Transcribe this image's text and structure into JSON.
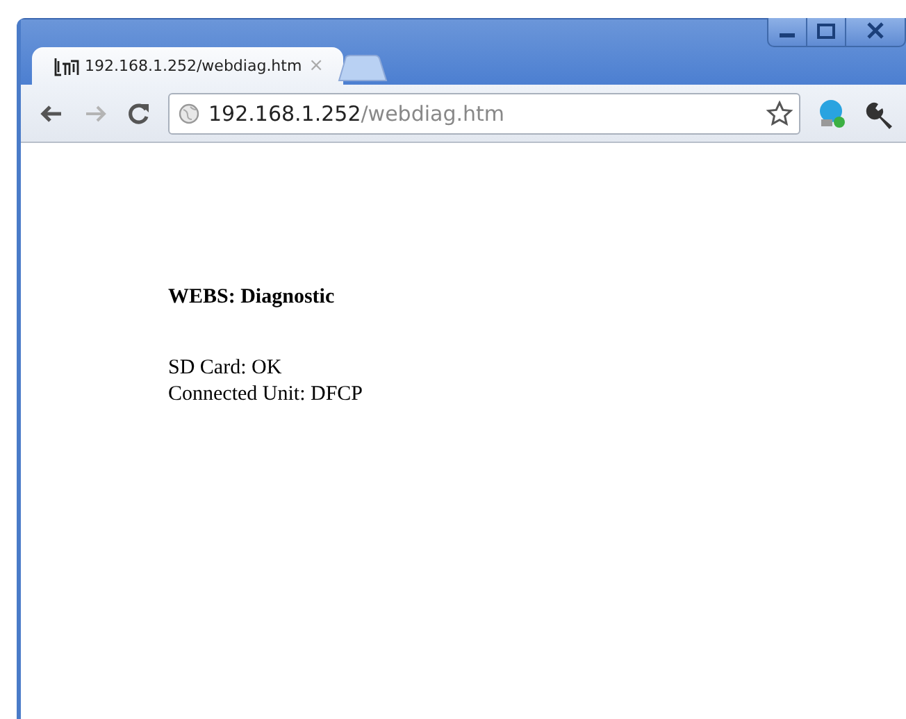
{
  "tab": {
    "title": "192.168.1.252/webdiag.htm",
    "close": "×"
  },
  "address_bar": {
    "host": "192.168.1.252",
    "path": "/webdiag.htm"
  },
  "page": {
    "heading": "WEBS: Diagnostic",
    "lines": [
      "SD Card: OK",
      "Connected Unit: DFCP"
    ]
  }
}
